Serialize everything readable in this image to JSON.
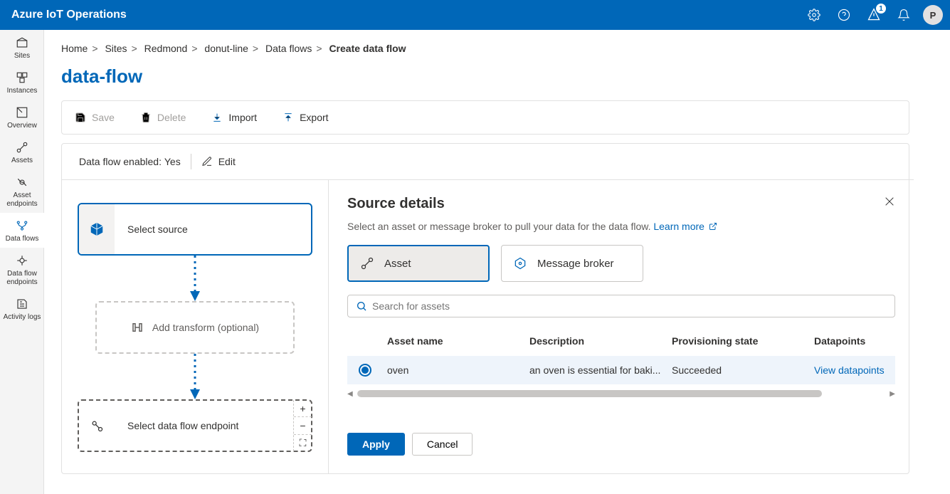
{
  "header": {
    "brand": "Azure IoT Operations",
    "alert_count": "1",
    "avatar_initial": "P"
  },
  "nav": {
    "items": [
      {
        "id": "sites",
        "label": "Sites"
      },
      {
        "id": "instances",
        "label": "Instances"
      },
      {
        "id": "overview",
        "label": "Overview"
      },
      {
        "id": "assets",
        "label": "Assets"
      },
      {
        "id": "asset-endpoints",
        "label": "Asset endpoints"
      },
      {
        "id": "data-flows",
        "label": "Data flows"
      },
      {
        "id": "data-flow-endpoints",
        "label": "Data flow endpoints"
      },
      {
        "id": "activity-logs",
        "label": "Activity logs"
      }
    ]
  },
  "breadcrumb": {
    "items": [
      "Home",
      "Sites",
      "Redmond",
      "donut-line",
      "Data flows"
    ],
    "current": "Create data flow",
    "sep": ">"
  },
  "page": {
    "title": "data-flow"
  },
  "toolbar": {
    "save": "Save",
    "delete": "Delete",
    "import": "Import",
    "export": "Export"
  },
  "status": {
    "enabled_label": "Data flow enabled:",
    "enabled_value": "Yes",
    "edit": "Edit"
  },
  "diagram": {
    "select_source": "Select source",
    "add_transform": "Add transform (optional)",
    "select_endpoint": "Select data flow endpoint",
    "plus": "+",
    "minus": "−",
    "full": "⛶"
  },
  "details": {
    "title": "Source details",
    "subtitle": "Select an asset or message broker to pull your data for the data flow.",
    "learn_more": "Learn more",
    "option_asset": "Asset",
    "option_broker": "Message broker",
    "search_placeholder": "Search for assets",
    "columns": {
      "asset_name": "Asset name",
      "description": "Description",
      "provisioning": "Provisioning state",
      "datapoints": "Datapoints"
    },
    "rows": [
      {
        "name": "oven",
        "desc": "an oven is essential for baki...",
        "state": "Succeeded",
        "dp": "View datapoints"
      }
    ],
    "scroll_left": "◀",
    "scroll_right": "▶",
    "apply": "Apply",
    "cancel": "Cancel"
  }
}
